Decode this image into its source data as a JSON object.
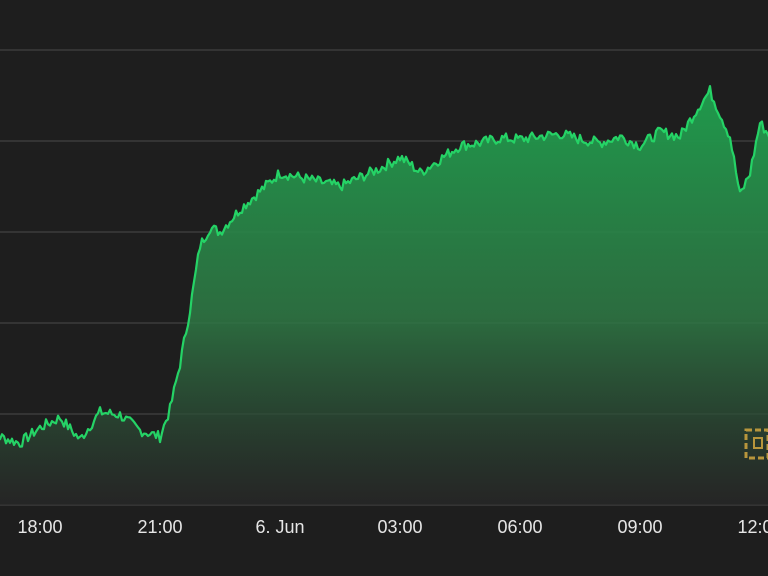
{
  "chart_data": {
    "type": "area",
    "title": "",
    "xlabel": "",
    "ylabel": "",
    "grid": true,
    "x_ticks": [
      "18:00",
      "21:00",
      "6. Jun",
      "03:00",
      "06:00",
      "09:00",
      "12:00"
    ],
    "x": [
      "16:30",
      "17:00",
      "17:30",
      "18:00",
      "18:30",
      "19:00",
      "19:30",
      "20:00",
      "20:30",
      "21:00",
      "21:15",
      "21:30",
      "21:45",
      "22:00",
      "22:15",
      "22:30",
      "23:00",
      "23:30",
      "00:00",
      "00:30",
      "01:00",
      "01:30",
      "02:00",
      "02:30",
      "03:00",
      "03:15",
      "03:30",
      "04:00",
      "04:30",
      "05:00",
      "05:30",
      "06:00",
      "06:30",
      "07:00",
      "07:30",
      "08:00",
      "08:30",
      "09:00",
      "09:30",
      "10:00",
      "10:30",
      "10:45",
      "11:00",
      "11:15",
      "11:30",
      "11:45",
      "12:00",
      "12:15",
      "12:30"
    ],
    "series": [
      {
        "values": [
          0.8,
          0.75,
          0.68,
          0.85,
          0.96,
          0.72,
          1.02,
          0.99,
          0.82,
          0.75,
          1.05,
          1.55,
          2.15,
          2.85,
          3.05,
          3.0,
          3.25,
          3.45,
          3.65,
          3.6,
          3.55,
          3.5,
          3.6,
          3.7,
          3.82,
          3.75,
          3.65,
          3.8,
          3.95,
          3.98,
          4.03,
          4.02,
          4.05,
          4.08,
          4.02,
          3.98,
          4.05,
          3.95,
          4.1,
          4.05,
          4.4,
          4.55,
          4.3,
          4.05,
          3.4,
          3.65,
          4.2,
          4.05,
          4.15
        ]
      }
    ],
    "ylim": [
      0,
      5
    ],
    "y_grid": [
      0,
      1,
      2,
      3,
      4,
      5
    ],
    "colors": {
      "line": "#25d366",
      "fill_top": "#1f9a4c",
      "fill_bottom": "#2a2a2a",
      "background": "#1e1e1e",
      "grid": "#4a4a4a",
      "text": "#e6e6e6",
      "watermark": "#b8963c"
    },
    "watermark_icon": "watermark-logo-icon"
  }
}
